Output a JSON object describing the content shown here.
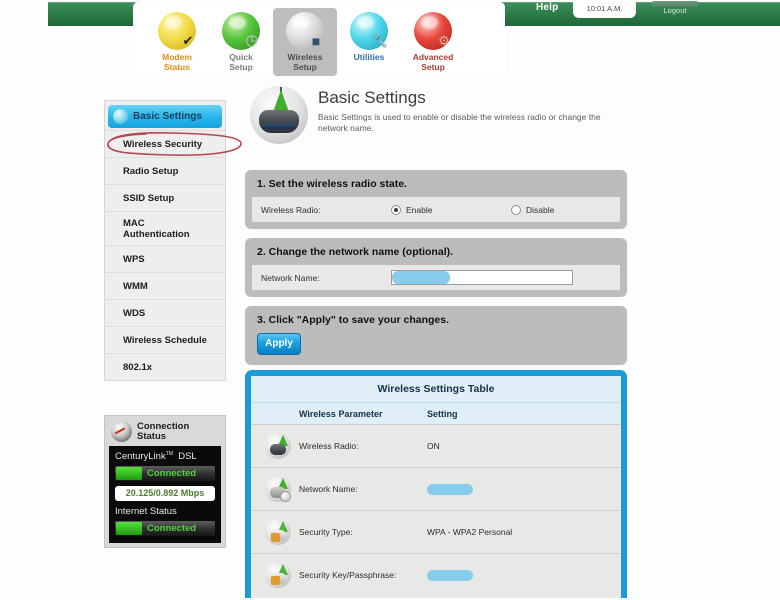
{
  "topbar": {
    "help_label": "Help",
    "clock": "10:01 A.M.",
    "logout_label": "Logout"
  },
  "nav": {
    "items": [
      {
        "label_line1": "Modem",
        "label_line2": "Status",
        "icon": "yellow-orb-check-icon",
        "active": false
      },
      {
        "label_line1": "Quick",
        "label_line2": "Setup",
        "icon": "green-orb-clock-icon",
        "active": false
      },
      {
        "label_line1": "Wireless",
        "label_line2": "Setup",
        "icon": "silver-orb-router-icon",
        "active": true
      },
      {
        "label_line1": "Utilities",
        "label_line2": "",
        "icon": "cyan-orb-tools-icon",
        "active": false
      },
      {
        "label_line1": "Advanced",
        "label_line2": "Setup",
        "icon": "red-orb-gears-icon",
        "active": false
      }
    ]
  },
  "sidebar": {
    "active_item": "Basic Settings",
    "items": [
      {
        "label": "Wireless Security",
        "annotated": true
      },
      {
        "label": "Radio Setup",
        "annotated": false
      },
      {
        "label": "SSID Setup",
        "annotated": false
      },
      {
        "label": "MAC Authentication",
        "annotated": false
      },
      {
        "label": "WPS",
        "annotated": false
      },
      {
        "label": "WMM",
        "annotated": false
      },
      {
        "label": "WDS",
        "annotated": false
      },
      {
        "label": "Wireless Schedule",
        "annotated": false
      },
      {
        "label": "802.1x",
        "annotated": false
      }
    ]
  },
  "connection_status": {
    "title_line1": "Connection",
    "title_line2": "Status",
    "isp_name": "CenturyLink",
    "isp_trademark": "TM",
    "isp_service": "DSL",
    "dsl_status": "Connected",
    "speed": "20.125/0.892 Mbps",
    "internet_label": "Internet Status",
    "internet_status": "Connected"
  },
  "main": {
    "title": "Basic Settings",
    "subtitle": "Basic Settings is used to enable or disable the wireless radio or change the network name.",
    "section1": {
      "heading": "1. Set the wireless radio state.",
      "field_label": "Wireless Radio:",
      "enable_label": "Enable",
      "disable_label": "Disable",
      "selected": "Enable"
    },
    "section2": {
      "heading": "2. Change the network name (optional).",
      "field_label": "Network Name:",
      "field_value": "",
      "redacted": true
    },
    "section3": {
      "heading": "3. Click \"Apply\" to save your changes.",
      "apply_label": "Apply"
    }
  },
  "wireless_table": {
    "title": "Wireless Settings Table",
    "columns": [
      "Wireless Parameter",
      "Setting"
    ],
    "rows": [
      {
        "icon": "router-radio-icon",
        "parameter": "Wireless Radio:",
        "setting": "ON",
        "redacted": false
      },
      {
        "icon": "network-name-icon",
        "parameter": "Network Name:",
        "setting": "",
        "redacted": true
      },
      {
        "icon": "security-key-icon",
        "parameter": "Security Type:",
        "setting": "WPA - WPA2 Personal",
        "redacted": false
      },
      {
        "icon": "security-key-icon",
        "parameter": "Security Key/Passphrase:",
        "setting": "",
        "redacted": true
      }
    ]
  },
  "colors": {
    "header_green": "#2b7a47",
    "accent_blue": "#1a9bd7",
    "sidebar_active": "#2bb6ec",
    "annotation_red": "#b2474f",
    "redaction_blue": "#87cdeb",
    "status_green": "#4fd23b"
  }
}
